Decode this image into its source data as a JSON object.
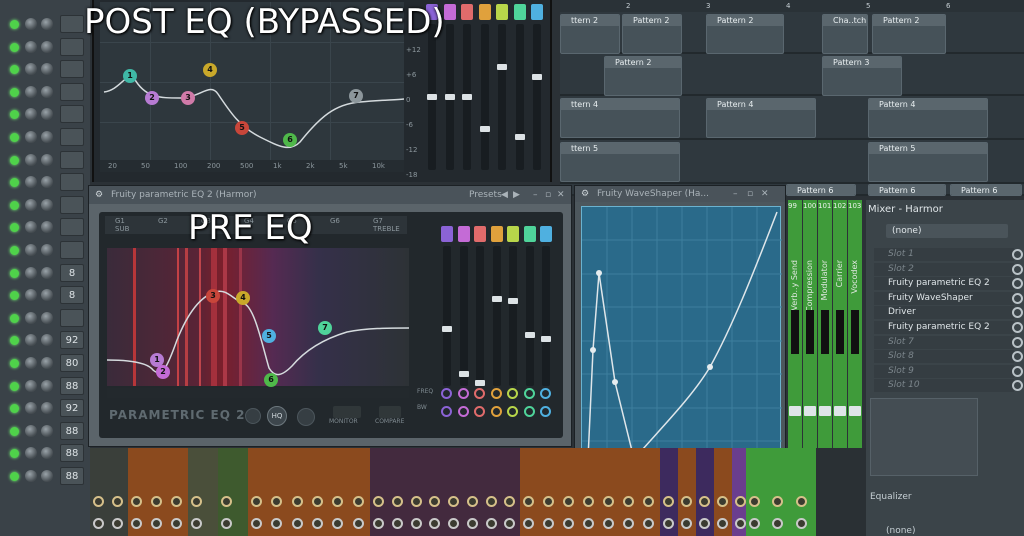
{
  "captions": {
    "post": "POST EQ (BYPASSED)",
    "pre": "PRE EQ"
  },
  "rack": {
    "numbers": [
      "",
      "",
      "",
      "",
      "",
      "",
      "",
      "",
      "",
      "",
      "",
      "8",
      "8",
      "",
      "92",
      "80",
      "88",
      "92",
      "88",
      "88",
      "88"
    ]
  },
  "post_eq": {
    "freq_labels": [
      "20",
      "50",
      "100",
      "200",
      "500",
      "1k",
      "2k",
      "5k",
      "10k"
    ],
    "db_labels": [
      "+12",
      "+6",
      "0",
      "-6",
      "-12",
      "-18"
    ],
    "nodes": [
      {
        "id": "1",
        "color": "#3fb8a6"
      },
      {
        "id": "2",
        "color": "#b77bd3"
      },
      {
        "id": "3",
        "color": "#d07aa8"
      },
      {
        "id": "4",
        "color": "#c9a82a"
      },
      {
        "id": "5",
        "color": "#c8463a"
      },
      {
        "id": "6",
        "color": "#4fb84a"
      },
      {
        "id": "7",
        "color": "#8c969b"
      }
    ]
  },
  "band_colors": [
    "#8b63d6",
    "#c46bd6",
    "#e06b6b",
    "#e0a13c",
    "#b8d64a",
    "#4fd49a",
    "#4fb0e0"
  ],
  "playlist": {
    "ruler": [
      "2",
      "3",
      "4",
      "5",
      "6"
    ],
    "clips": [
      {
        "label": "ttern 2"
      },
      {
        "label": "Pattern 2"
      },
      {
        "label": "Pattern 2"
      },
      {
        "label": "Cha..tch"
      },
      {
        "label": "Pattern 2"
      },
      {
        "label": "Pattern 2"
      },
      {
        "label": "Pattern 3"
      },
      {
        "label": "ttern 4"
      },
      {
        "label": "Pattern 4"
      },
      {
        "label": "Pattern 4"
      },
      {
        "label": "ttern 5"
      },
      {
        "label": "Pattern 5"
      },
      {
        "label": "Pattern 6"
      },
      {
        "label": "Pattern 6"
      },
      {
        "label": "Pattern 6"
      }
    ]
  },
  "pre_eq": {
    "title": "Fruity parametric EQ 2 (Harmor)",
    "presets": "Presets",
    "logo": "PARAMETRIC EQ 2",
    "monitor": "MONITOR",
    "compare": "COMPARE",
    "header_cells": [
      "G1",
      "G2",
      "G3",
      "G4",
      "G5",
      "G6",
      "G7"
    ],
    "header_sub": [
      "SUB",
      "",
      "",
      "",
      "",
      "",
      "TREBLE"
    ],
    "freq_label": "FREQ",
    "bw_label": "BW",
    "nodes": [
      {
        "id": "1"
      },
      {
        "id": "2"
      },
      {
        "id": "3"
      },
      {
        "id": "4"
      },
      {
        "id": "5"
      },
      {
        "id": "6"
      },
      {
        "id": "7"
      }
    ]
  },
  "waveshaper": {
    "title": "Fruity WaveShaper (Ha..."
  },
  "mixer": {
    "title": "Mixer - Harmor",
    "route": "(none)",
    "route_bottom": "(none)",
    "equalizer": "Equalizer",
    "channel_numbers": [
      "99",
      "100",
      "101",
      "102",
      "103"
    ],
    "channel_names": [
      "Verb..y Send",
      "Compression",
      "Modulator",
      "Carrier",
      "Vocodex"
    ],
    "slots": [
      {
        "label": "Slot 1",
        "empty": true
      },
      {
        "label": "Slot 2",
        "empty": true
      },
      {
        "label": "Fruity parametric EQ 2",
        "empty": false
      },
      {
        "label": "Fruity WaveShaper",
        "empty": false
      },
      {
        "label": "Driver",
        "empty": false
      },
      {
        "label": "Fruity parametric EQ 2",
        "empty": false
      },
      {
        "label": "Slot 7",
        "empty": true
      },
      {
        "label": "Slot 8",
        "empty": true
      },
      {
        "label": "Slot 9",
        "empty": true
      },
      {
        "label": "Slot 10",
        "empty": true
      }
    ]
  }
}
